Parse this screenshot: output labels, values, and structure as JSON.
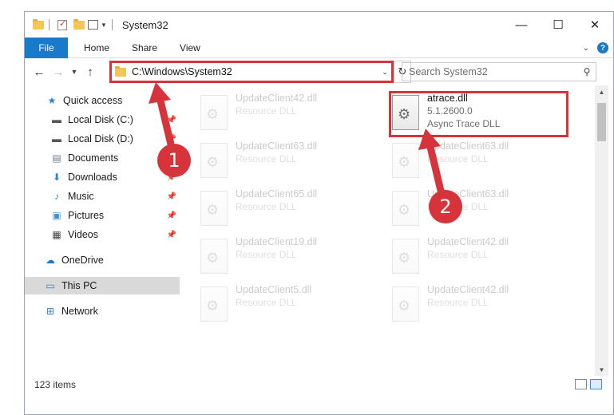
{
  "window": {
    "title": "System32",
    "controls": {
      "minimize": "—",
      "maximize": "☐",
      "close": "✕"
    }
  },
  "ribbon": {
    "tabs": [
      "File",
      "Home",
      "Share",
      "View"
    ],
    "help": "?"
  },
  "address": {
    "path": "C:\\Windows\\System32",
    "search_placeholder": "Search System32"
  },
  "nav": {
    "items": [
      {
        "label": "Quick access",
        "icon": "star-icon"
      },
      {
        "label": "Local Disk (C:)",
        "icon": "drive-icon"
      },
      {
        "label": "Local Disk (D:)",
        "icon": "drive-icon"
      },
      {
        "label": "Documents",
        "icon": "documents-icon"
      },
      {
        "label": "Downloads",
        "icon": "download-icon"
      },
      {
        "label": "Music",
        "icon": "music-icon"
      },
      {
        "label": "Pictures",
        "icon": "pictures-icon"
      },
      {
        "label": "Videos",
        "icon": "videos-icon"
      },
      {
        "label": "OneDrive",
        "icon": "cloud-icon"
      },
      {
        "label": "This PC",
        "icon": "computer-icon"
      },
      {
        "label": "Network",
        "icon": "network-icon"
      }
    ]
  },
  "files": {
    "left": [
      {
        "name": "UpdateClient42.dll",
        "desc": "Resource DLL"
      },
      {
        "name": "UpdateClient63.dll",
        "desc": "Resource DLL"
      },
      {
        "name": "UpdateClient65.dll",
        "desc": "Resource DLL"
      },
      {
        "name": "UpdateClient19.dll",
        "desc": "Resource DLL"
      },
      {
        "name": "UpdateClient5.dll",
        "desc": "Resource DLL"
      }
    ],
    "right": [
      {
        "name": "atrace.dll",
        "version": "5.1.2600.0",
        "desc": "Async Trace DLL"
      },
      {
        "name": "UpdateClient63.dll",
        "desc": "Resource DLL"
      },
      {
        "name": "UpdateClient63.dll",
        "desc": "Resource DLL"
      },
      {
        "name": "UpdateClient42.dll",
        "desc": "Resource DLL"
      },
      {
        "name": "UpdateClient42.dll",
        "desc": "Resource DLL"
      }
    ]
  },
  "status": {
    "count": "123 items"
  },
  "annotations": {
    "step1": "1",
    "step2": "2",
    "color": "#d6343a"
  }
}
